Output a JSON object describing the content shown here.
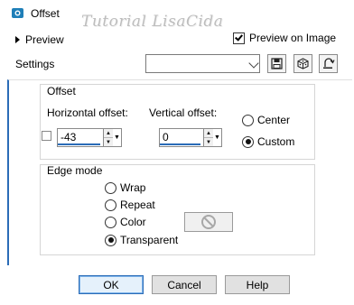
{
  "window": {
    "title": "Offset",
    "watermark": "Tutorial LisaCida"
  },
  "preview": {
    "toggle_label": "Preview",
    "checkbox_label": "Preview on Image",
    "checked": true
  },
  "settings": {
    "label": "Settings",
    "value": ""
  },
  "offset_group": {
    "title": "Offset",
    "horizontal_label": "Horizontal offset:",
    "horizontal_value": "-43",
    "vertical_label": "Vertical offset:",
    "vertical_value": "0",
    "radios": [
      {
        "label": "Center",
        "selected": false
      },
      {
        "label": "Custom",
        "selected": true
      }
    ]
  },
  "edge_group": {
    "title": "Edge mode",
    "options": [
      {
        "label": "Wrap",
        "selected": false
      },
      {
        "label": "Repeat",
        "selected": false
      },
      {
        "label": "Color",
        "selected": false
      },
      {
        "label": "Transparent",
        "selected": true
      }
    ]
  },
  "buttons": {
    "ok": "OK",
    "cancel": "Cancel",
    "help": "Help"
  },
  "colors": {
    "accent": "#2b6cb7",
    "app_icon": "#1f7fb8"
  }
}
